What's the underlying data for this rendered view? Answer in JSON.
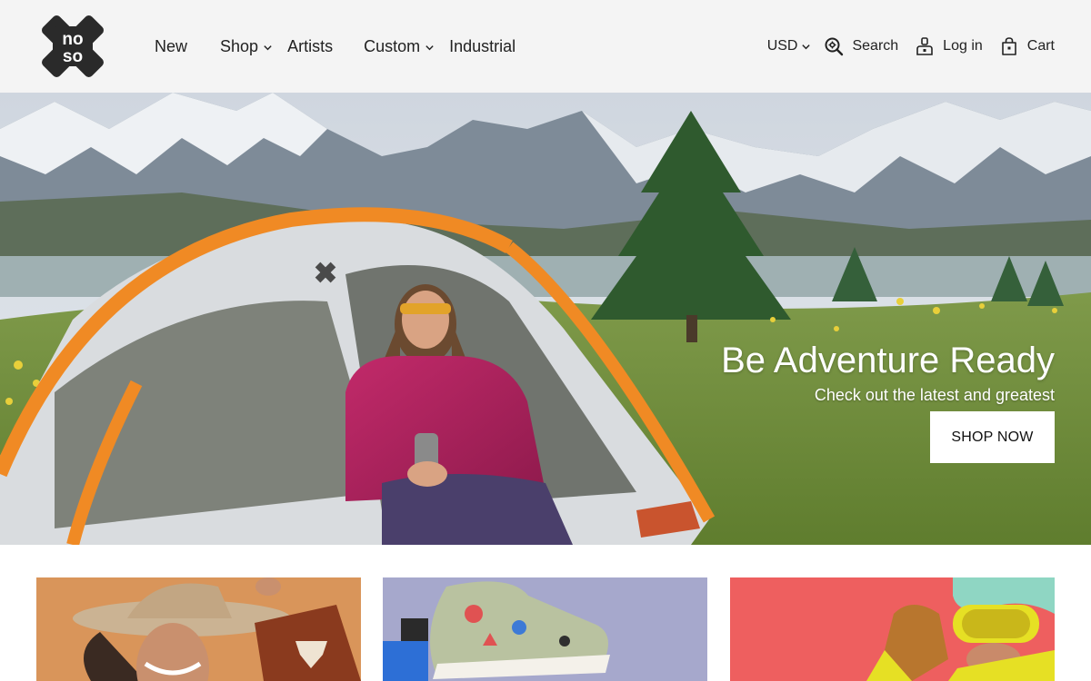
{
  "brand": {
    "logo_text_top": "no",
    "logo_text_bottom": "so"
  },
  "nav": {
    "items": [
      {
        "label": "New",
        "has_dropdown": false
      },
      {
        "label": "Shop",
        "has_dropdown": true
      },
      {
        "label": "Artists",
        "has_dropdown": false
      },
      {
        "label": "Custom",
        "has_dropdown": true
      },
      {
        "label": "Industrial",
        "has_dropdown": false
      }
    ]
  },
  "utilities": {
    "currency": "USD",
    "search": "Search",
    "login": "Log in",
    "cart": "Cart"
  },
  "hero": {
    "title": "Be Adventure Ready",
    "subtitle": "Check out the latest and greatest",
    "cta": "SHOP NOW"
  },
  "cards": [
    {
      "bg": "#d9955a",
      "subject": "cowboy-hat-portrait"
    },
    {
      "bg": "#a6a8cc",
      "subject": "patched-sneaker"
    },
    {
      "bg": "#ee5f5f",
      "subject": "ski-goggles"
    }
  ],
  "icons": {
    "search": "search-icon",
    "login": "user-icon",
    "cart": "shopping-bag-icon",
    "dropdown": "chevron-down-icon"
  },
  "colors": {
    "header_bg": "#f4f4f4",
    "text": "#222222",
    "accent_tent": "#f08a24",
    "button_bg": "#ffffff"
  }
}
